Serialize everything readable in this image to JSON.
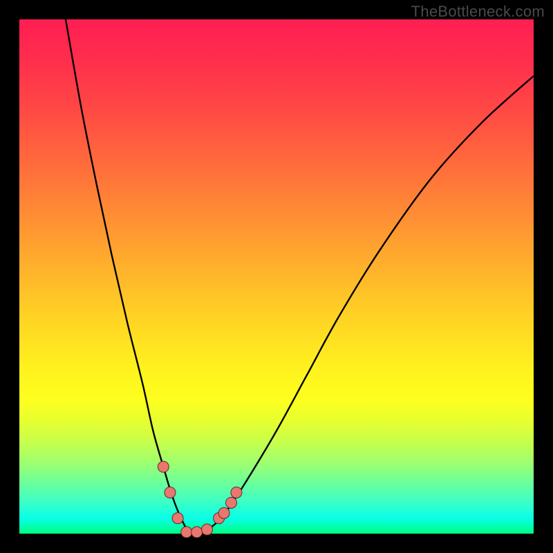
{
  "watermark": "TheBottleneck.com",
  "colors": {
    "frame": "#000000",
    "curve_stroke": "#000000",
    "marker_fill": "#e9766f",
    "marker_stroke": "#5b2b27"
  },
  "chart_data": {
    "type": "line",
    "title": "",
    "xlabel": "",
    "ylabel": "",
    "xlim": [
      0,
      100
    ],
    "ylim": [
      0,
      100
    ],
    "grid": false,
    "legend": false,
    "series": [
      {
        "name": "curve",
        "x": [
          9,
          12,
          15,
          18,
          21,
          24,
          26,
          28,
          29.5,
          31,
          33,
          35,
          37,
          40,
          44,
          50,
          56,
          62,
          70,
          80,
          90,
          100
        ],
        "y": [
          100,
          83,
          68,
          54,
          41,
          29,
          20,
          13,
          8,
          4,
          0.3,
          0.3,
          1,
          4,
          10,
          20,
          31,
          42,
          55,
          69,
          80,
          89
        ]
      }
    ],
    "markers": [
      {
        "x": 28.0,
        "y": 13.0
      },
      {
        "x": 29.3,
        "y": 8.0
      },
      {
        "x": 30.8,
        "y": 3.0
      },
      {
        "x": 32.5,
        "y": 0.3
      },
      {
        "x": 34.5,
        "y": 0.3
      },
      {
        "x": 36.5,
        "y": 0.8
      },
      {
        "x": 38.8,
        "y": 3.0
      },
      {
        "x": 39.8,
        "y": 4.0
      },
      {
        "x": 41.2,
        "y": 6.0
      },
      {
        "x": 42.2,
        "y": 8.0
      }
    ]
  }
}
